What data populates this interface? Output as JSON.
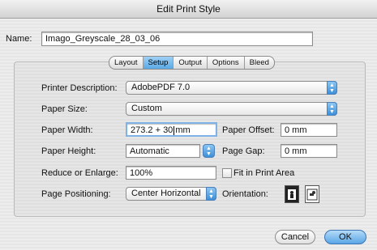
{
  "window": {
    "title": "Edit Print Style"
  },
  "name": {
    "label": "Name:",
    "value": "Imago_Greyscale_28_03_06"
  },
  "tabs": [
    {
      "label": "Layout",
      "active": false
    },
    {
      "label": "Setup",
      "active": true
    },
    {
      "label": "Output",
      "active": false
    },
    {
      "label": "Options",
      "active": false
    },
    {
      "label": "Bleed",
      "active": false
    }
  ],
  "setup": {
    "printer_description": {
      "label": "Printer Description:",
      "value": "AdobePDF 7.0"
    },
    "paper_size": {
      "label": "Paper Size:",
      "value": "Custom"
    },
    "paper_width": {
      "label": "Paper Width:",
      "value_before_cursor": "273.2 + 30",
      "value_after_cursor": "mm"
    },
    "paper_offset": {
      "label": "Paper Offset:",
      "value": "0 mm"
    },
    "paper_height": {
      "label": "Paper Height:",
      "value": "Automatic"
    },
    "page_gap": {
      "label": "Page Gap:",
      "value": "0 mm"
    },
    "reduce_enlarge": {
      "label": "Reduce or Enlarge:",
      "value": "100%"
    },
    "fit_in_print_area": {
      "label": "Fit in Print Area",
      "checked": false
    },
    "page_positioning": {
      "label": "Page Positioning:",
      "value": "Center Horizontal"
    },
    "orientation": {
      "label": "Orientation:",
      "selected": "portrait"
    }
  },
  "buttons": {
    "cancel": "Cancel",
    "ok": "OK"
  },
  "icons": {
    "popup": "up-down-arrows-icon",
    "portrait": "portrait-orientation-icon",
    "landscape": "landscape-orientation-icon"
  }
}
